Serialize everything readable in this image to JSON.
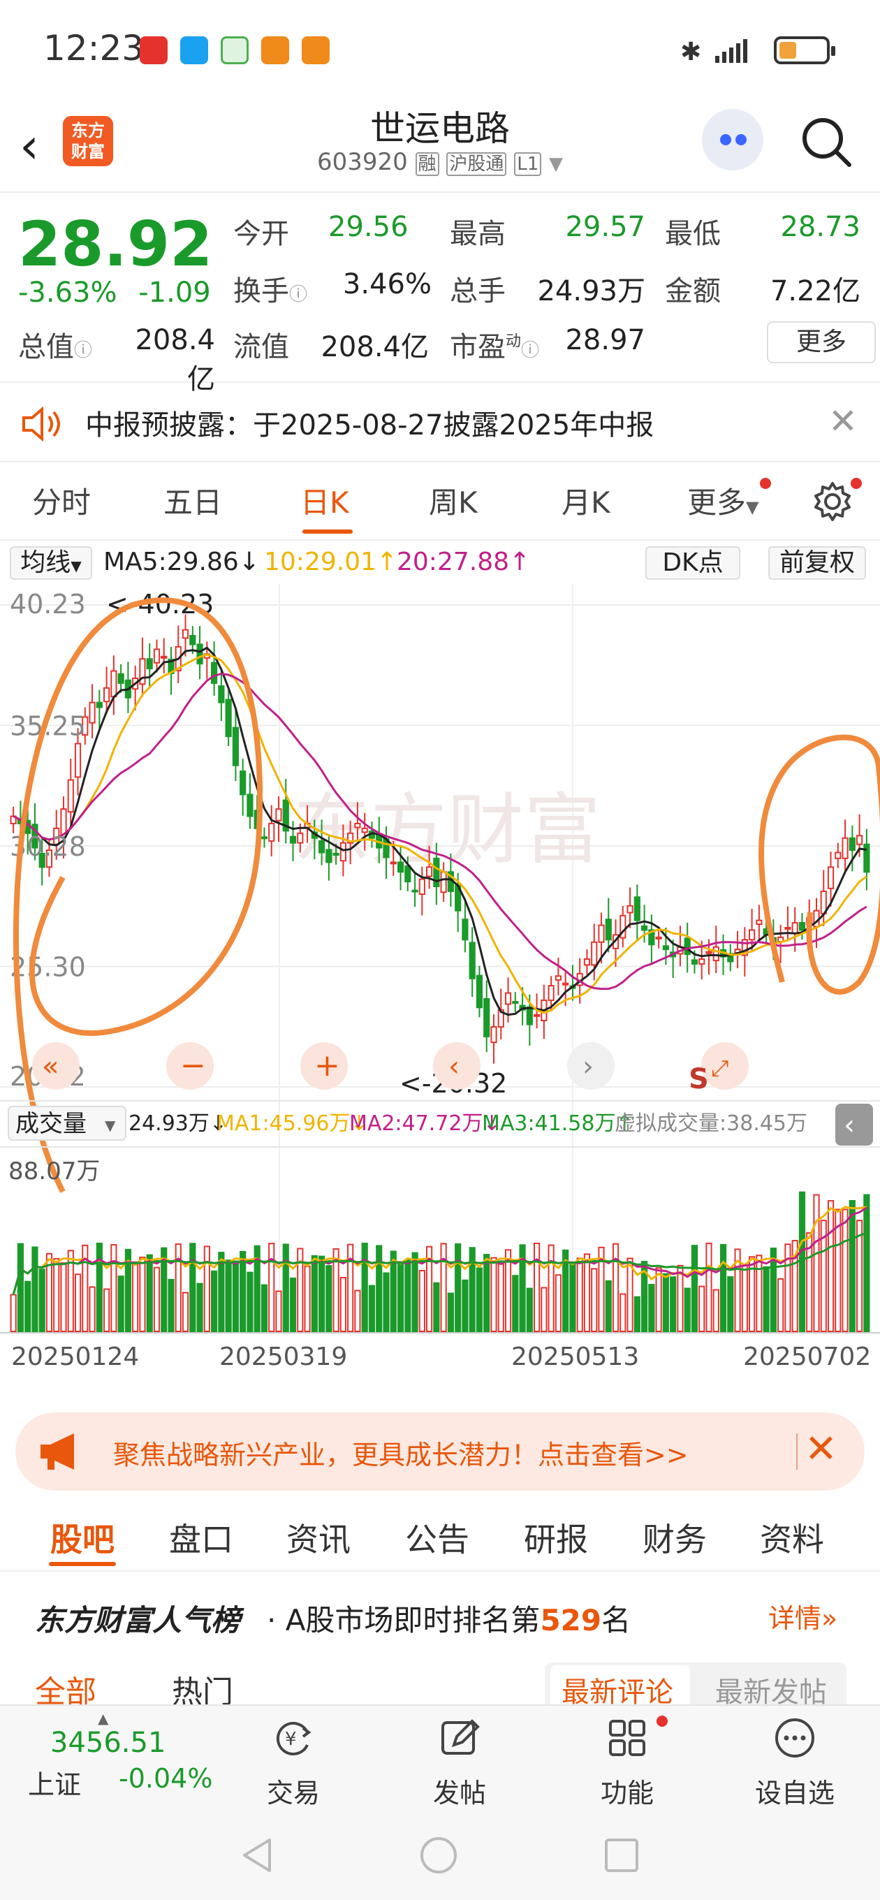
{
  "status_bar": {
    "time": "12:23"
  },
  "header": {
    "back_icon": "chevron-left-icon",
    "logo_text_1": "东方",
    "logo_text_2": "财富",
    "stock_name": "世运电路",
    "stock_code": "603920",
    "badge_margin": "融",
    "badge_connect": "沪股通",
    "badge_level": "L1"
  },
  "quote": {
    "price": "28.92",
    "change_pct": "-3.63%",
    "change_abs": "-1.09",
    "open_label": "今开",
    "open": "29.56",
    "high_label": "最高",
    "high": "29.57",
    "low_label": "最低",
    "low": "28.73",
    "turnover_label": "换手",
    "turnover": "3.46%",
    "volume_label": "总手",
    "volume": "24.93万",
    "amount_label": "金额",
    "amount": "7.22亿",
    "mktcap_label": "总值",
    "mktcap": "208.4亿",
    "float_label": "流值",
    "float": "208.4亿",
    "pe_label": "市盈",
    "pe_sup": "动",
    "pe": "28.97",
    "more_btn": "更多"
  },
  "notice": {
    "text": "中报预披露：于2025-08-27披露2025年中报"
  },
  "chart_tabs": {
    "items": [
      "分时",
      "五日",
      "日K",
      "周K",
      "月K",
      "更多"
    ],
    "active": "日K"
  },
  "ma_row": {
    "select": "均线",
    "ma5": "MA5:29.86↓",
    "ma10": "10:29.01↑",
    "ma20": "20:27.88↑",
    "dk": "DK点",
    "adjust": "前复权"
  },
  "volume_row": {
    "select": "成交量",
    "vol": "24.93万↓",
    "ma1": "MA1:45.96万↓",
    "ma2": "MA2:47.72万↓",
    "ma3": "MA3:41.58万↑",
    "virtual": "虚拟成交量:38.45万",
    "max_label": "88.07万"
  },
  "colors": {
    "up": "#e5322d",
    "down": "#1a9a2a",
    "ma5": "#222222",
    "ma10": "#f0b400",
    "ma20": "#c0208a",
    "accent": "#e8570c"
  },
  "chart_data": {
    "type": "candlestick",
    "yaxis_ticks": [
      "40.23",
      "35.25",
      "30.28",
      "25.30",
      "20.32"
    ],
    "ylim": [
      20.32,
      40.23
    ],
    "x_ticks": [
      "20250124",
      "20250319",
      "20250513",
      "20250702"
    ],
    "annotations": {
      "max": "<-40.23",
      "min": "<-20.32"
    },
    "watermark": "东方财富",
    "close_series": [
      31.5,
      31.2,
      30.8,
      30.2,
      29.4,
      30.1,
      31.0,
      31.8,
      33.0,
      34.5,
      35.6,
      36.2,
      36.0,
      36.8,
      37.5,
      37.0,
      36.4,
      37.2,
      38.0,
      37.6,
      38.4,
      38.1,
      37.4,
      38.5,
      39.2,
      38.6,
      37.8,
      38.2,
      37.0,
      36.2,
      34.8,
      33.6,
      32.4,
      31.5,
      31.0,
      30.6,
      31.2,
      31.8,
      30.9,
      30.4,
      30.8,
      31.2,
      30.6,
      30.0,
      29.6,
      29.9,
      30.4,
      30.8,
      31.2,
      31.0,
      30.6,
      30.2,
      29.8,
      29.6,
      29.2,
      28.8,
      28.4,
      28.9,
      29.4,
      28.6,
      29.2,
      28.4,
      27.6,
      26.4,
      24.8,
      23.6,
      22.4,
      22.8,
      23.5,
      24.2,
      23.8,
      23.5,
      22.9,
      23.3,
      23.9,
      24.5,
      24.9,
      24.6,
      24.4,
      25.0,
      25.6,
      26.3,
      27.0,
      26.4,
      26.6,
      27.4,
      27.8,
      27.2,
      26.8,
      26.2,
      26.5,
      26.0,
      25.7,
      26.1,
      25.8,
      25.4,
      25.6,
      25.9,
      26.1,
      25.7,
      25.5,
      26.0,
      26.4,
      26.8,
      27.2,
      26.6,
      26.2,
      26.5,
      26.9,
      27.1,
      26.8,
      27.3,
      27.6,
      28.4,
      29.4,
      30.0,
      30.6,
      30.1,
      30.7,
      29.2
    ],
    "volume_ma": {
      "ma1": "MA1",
      "ma2": "MA2",
      "ma3": "MA3"
    }
  },
  "banner": {
    "text": "聚焦战略新兴产业，更具成长潜力！点击查看>>"
  },
  "content_tabs": {
    "items": [
      "股吧",
      "盘口",
      "资讯",
      "公告",
      "研报",
      "财务",
      "资料"
    ],
    "active": "股吧"
  },
  "rank": {
    "title": "东方财富人气榜",
    "prefix": "· A股市场即时排名第",
    "rank": "529",
    "suffix": "名",
    "detail": "详情"
  },
  "subtabs": {
    "items": [
      "全部",
      "热门",
      "最新评论",
      "最新发帖"
    ]
  },
  "footer": {
    "index_value": "3456.51",
    "index_name": "上证",
    "index_change": "-0.04%",
    "nav": [
      "交易",
      "发帖",
      "功能",
      "设自选"
    ]
  }
}
